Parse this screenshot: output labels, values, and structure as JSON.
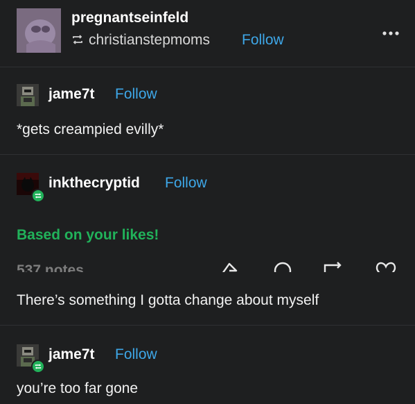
{
  "header": {
    "username": "pregnantseinfeld",
    "reblogged_from": "christianstepmoms",
    "follow_label": "Follow",
    "more_icon": "ellipsis-icon"
  },
  "posts": [
    {
      "username": "jame7t",
      "follow_label": "Follow",
      "text": "*gets creampied evilly*"
    },
    {
      "username": "inkthecryptid",
      "follow_label": "Follow",
      "text": "There’s something I gotta change about myself"
    },
    {
      "username": "jame7t",
      "follow_label": "Follow",
      "text": "you’re too far gone"
    }
  ],
  "recommendation": {
    "label": "Based on your likes!"
  },
  "notes": {
    "count_label": "537 notes"
  },
  "actions": [
    "share-icon",
    "reply-icon",
    "reblog-icon",
    "like-icon"
  ],
  "colors": {
    "background": "#1e1f20",
    "follow": "#3ea7e8",
    "based_green": "#21b25a",
    "badge_green": "#21b25a"
  }
}
